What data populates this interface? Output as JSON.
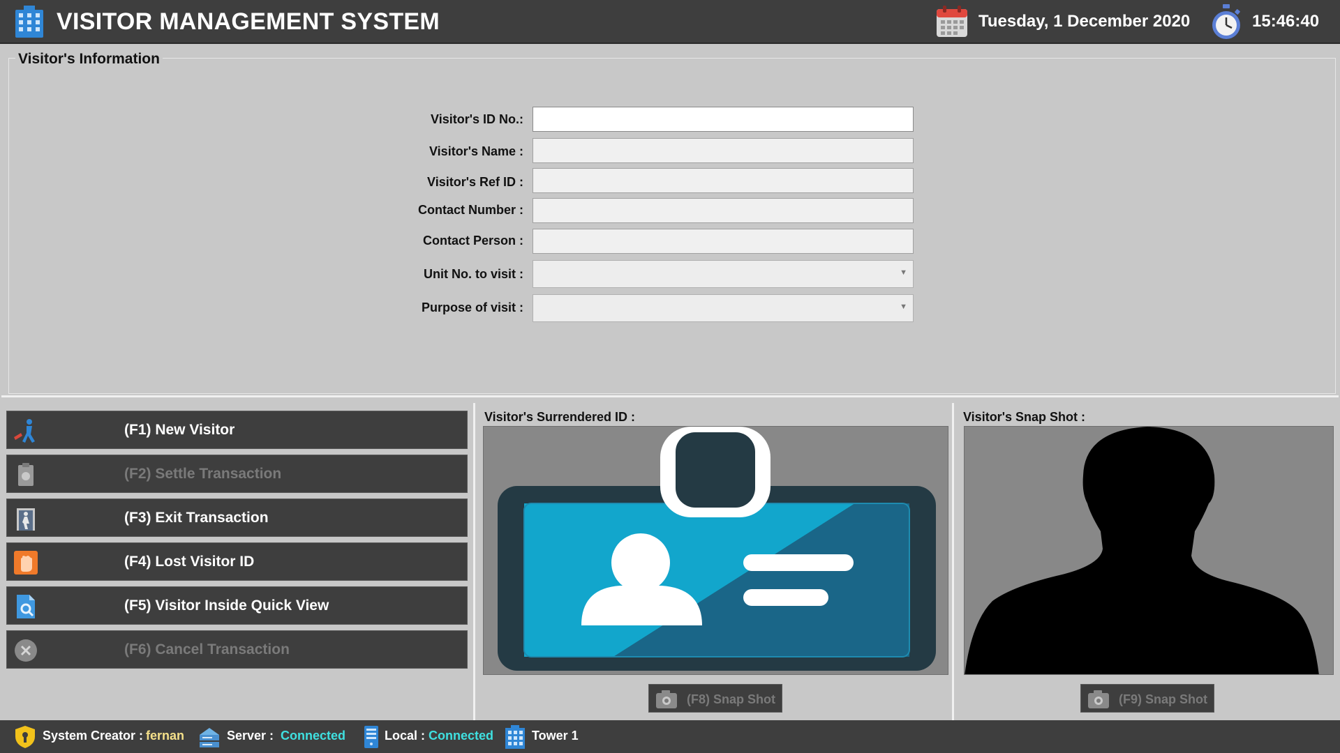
{
  "header": {
    "title": "VISITOR MANAGEMENT SYSTEM",
    "date": "Tuesday, 1 December 2020",
    "time": "15:46:40",
    "icons": [
      "building-icon",
      "calendar-icon",
      "stopwatch-icon"
    ]
  },
  "info": {
    "legend": "Visitor's Information",
    "fields": {
      "id_no": {
        "label": "Visitor's ID No.:",
        "value": ""
      },
      "name": {
        "label": "Visitor's Name :",
        "value": ""
      },
      "ref_id": {
        "label": "Visitor's Ref ID :",
        "value": ""
      },
      "contact_number": {
        "label": "Contact Number :",
        "value": ""
      },
      "contact_person": {
        "label": "Contact Person :",
        "value": ""
      },
      "unit_no": {
        "label": "Unit No. to visit :",
        "value": ""
      },
      "purpose": {
        "label": "Purpose of visit :",
        "value": ""
      }
    }
  },
  "menu": [
    {
      "key": "F1",
      "label": "(F1) New Visitor",
      "icon": "walking-person-icon",
      "enabled": true
    },
    {
      "key": "F2",
      "label": "(F2) Settle Transaction",
      "icon": "clipboard-icon",
      "enabled": false
    },
    {
      "key": "F3",
      "label": "(F3) Exit Transaction",
      "icon": "exit-door-icon",
      "enabled": true
    },
    {
      "key": "F4",
      "label": "(F4) Lost Visitor ID",
      "icon": "stop-hand-icon",
      "enabled": true
    },
    {
      "key": "F5",
      "label": "(F5) Visitor Inside Quick View",
      "icon": "document-search-icon",
      "enabled": true
    },
    {
      "key": "F6",
      "label": "(F6) Cancel Transaction",
      "icon": "cancel-circle-icon",
      "enabled": false
    }
  ],
  "surrendered_id": {
    "title": "Visitor's Surrendered ID :",
    "snap_label": "(F8) Snap Shot"
  },
  "snapshot": {
    "title": "Visitor's Snap Shot :",
    "snap_label": "(F9) Snap Shot"
  },
  "status": {
    "creator_label": "System Creator :",
    "creator_value": "fernan",
    "server_label": "Server :",
    "server_value": "Connected",
    "local_label": "Local :",
    "local_value": "Connected",
    "location": "Tower 1"
  },
  "colors": {
    "header_bg": "#3e3e3e",
    "panel_bg": "#c8c8c8",
    "creator_value": "#f5e08a",
    "connected": "#3fe0e0",
    "id_card_blue": "#14a3c7",
    "id_card_dark": "#1a6a8a"
  }
}
